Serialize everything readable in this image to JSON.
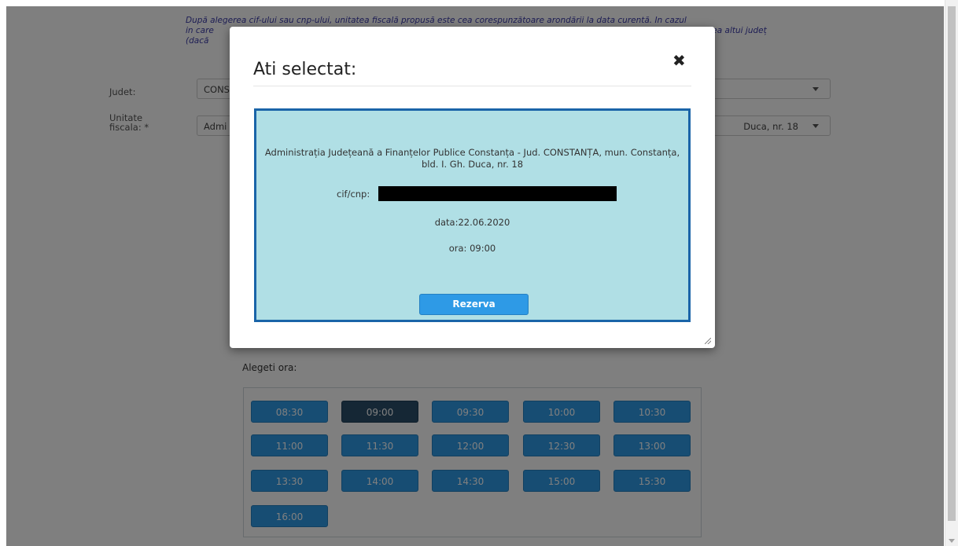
{
  "notice": {
    "line1": "După alegerea cif-ului sau cnp-ului, unitatea fiscală propusă este cea corespunzătoare arondării la data curentă. In cazul",
    "line2": "in care",
    "line2_right": "rea altui județ",
    "line3": "(dacă"
  },
  "form": {
    "judet_label": "Judet:",
    "judet_value": "CONS",
    "unitate_label_1": "Unitate",
    "unitate_label_2": "fiscala:  *",
    "unitate_value": "Admi",
    "unitate_value_right": "Duca, nr. 18"
  },
  "alegeti_ora_label": "Alegeti ora:",
  "time_slots": [
    "08:30",
    "09:00",
    "09:30",
    "10:00",
    "10:30",
    "11:00",
    "11:30",
    "12:00",
    "12:30",
    "13:00",
    "13:30",
    "14:00",
    "14:30",
    "15:00",
    "15:30",
    "16:00"
  ],
  "selected_slot": "09:00",
  "modal": {
    "title": "Ati selectat:",
    "close_icon": "close-icon",
    "address": "Administrația Județeană a Finanțelor Publice Constanța - Jud. CONSTANȚA, mun. Constanța, bld. I. Gh. Duca, nr. 18",
    "cif_label": "cif/cnp:",
    "data_text": "data:22.06.2020",
    "ora_text": "ora: 09:00",
    "button_label": "Rezerva"
  },
  "colors": {
    "button_blue": "#2e9ae6",
    "selected_slot": "#2a4f6b",
    "modal_panel_bg": "#b0dfe5",
    "modal_panel_border": "#1a64a8",
    "notice_text": "#3a3aa8"
  }
}
